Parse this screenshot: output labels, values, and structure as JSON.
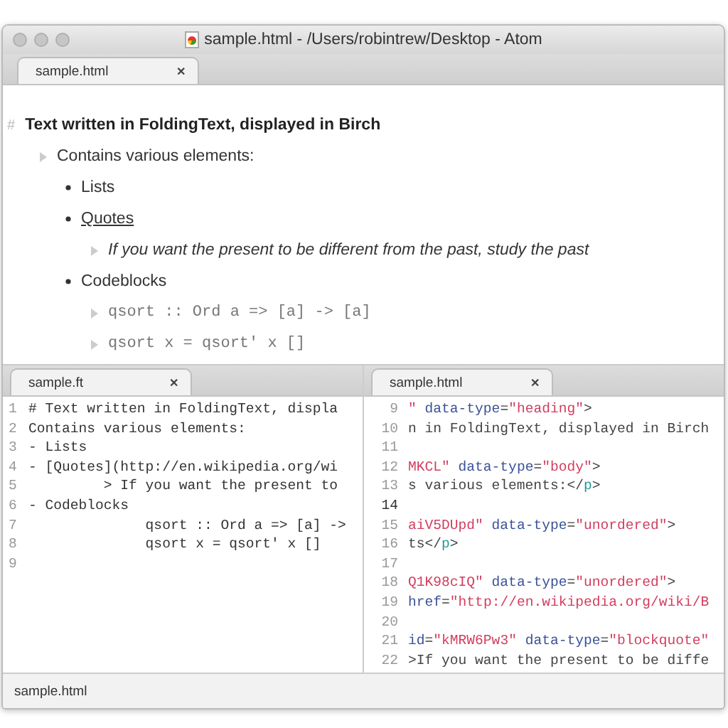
{
  "window": {
    "title": "sample.html - /Users/robintrew/Desktop - Atom"
  },
  "top_tabs": [
    {
      "label": "sample.html",
      "close": "✕",
      "selected": true
    }
  ],
  "preview": [
    {
      "kind": "heading",
      "marker": "#",
      "text": "Text written in FoldingText, displayed in Birch",
      "children": [
        {
          "kind": "item",
          "text": "Contains various elements:",
          "children": [
            {
              "kind": "bullet",
              "text": "Lists"
            },
            {
              "kind": "link",
              "text": "Quotes",
              "children": [
                {
                  "kind": "quote",
                  "text": "If you want the present to be different from the past, study the past"
                }
              ]
            },
            {
              "kind": "bullet",
              "text": "Codeblocks",
              "children": [
                {
                  "kind": "code",
                  "text": "qsort :: Ord a => [a] -> [a]"
                },
                {
                  "kind": "code",
                  "text": "qsort x = qsort' x []"
                }
              ]
            }
          ]
        }
      ]
    }
  ],
  "left_pane": {
    "tab": {
      "label": "sample.ft",
      "close": "✕",
      "selected": true
    },
    "lines": [
      {
        "number": "1",
        "text": "# Text written in FoldingText, displa"
      },
      {
        "number": "2",
        "text": "Contains various elements:"
      },
      {
        "number": "3",
        "text": "- Lists"
      },
      {
        "number": "4",
        "text": "- [Quotes](http://en.wikipedia.org/wi"
      },
      {
        "number": "5",
        "text": "         > If you want the present to"
      },
      {
        "number": "6",
        "text": "- Codeblocks"
      },
      {
        "number": "7",
        "text": "              qsort :: Ord a => [a] ->"
      },
      {
        "number": "8",
        "text": "              qsort x = qsort' x []"
      },
      {
        "number": "9"
      }
    ]
  },
  "right_pane": {
    "tab": {
      "label": "sample.html",
      "close": "✕",
      "selected": true
    },
    "lines": [
      {
        "number": "9",
        "current": false,
        "tokens": [
          {
            "kind": "str",
            "text": "\""
          },
          {
            "kind": "attr",
            "text": " data-type"
          },
          {
            "kind": "plain",
            "text": "="
          },
          {
            "kind": "str",
            "text": "\"heading\""
          },
          {
            "kind": "plain",
            "text": ">"
          }
        ]
      },
      {
        "number": "10",
        "current": false,
        "tokens": [
          {
            "kind": "plain",
            "text": "n in FoldingText, displayed in Birch"
          }
        ]
      },
      {
        "number": "11",
        "current": false
      },
      {
        "number": "12",
        "current": false,
        "tokens": [
          {
            "kind": "str",
            "text": "MKCL\""
          },
          {
            "kind": "attr",
            "text": " data-type"
          },
          {
            "kind": "plain",
            "text": "="
          },
          {
            "kind": "str",
            "text": "\"body\""
          },
          {
            "kind": "plain",
            "text": ">"
          }
        ]
      },
      {
        "number": "13",
        "current": false,
        "tokens": [
          {
            "kind": "plain",
            "text": "s various elements:</"
          },
          {
            "kind": "tag",
            "text": "p"
          },
          {
            "kind": "plain",
            "text": ">"
          }
        ]
      },
      {
        "number": "14",
        "current": true
      },
      {
        "number": "15",
        "current": false,
        "tokens": [
          {
            "kind": "str",
            "text": "aiV5DUpd\""
          },
          {
            "kind": "attr",
            "text": " data-type"
          },
          {
            "kind": "plain",
            "text": "="
          },
          {
            "kind": "str",
            "text": "\"unordered\""
          },
          {
            "kind": "plain",
            "text": ">"
          }
        ]
      },
      {
        "number": "16",
        "current": false,
        "tokens": [
          {
            "kind": "plain",
            "text": "ts</"
          },
          {
            "kind": "tag",
            "text": "p"
          },
          {
            "kind": "plain",
            "text": ">"
          }
        ]
      },
      {
        "number": "17",
        "current": false
      },
      {
        "number": "18",
        "current": false,
        "tokens": [
          {
            "kind": "str",
            "text": "Q1K98cIQ\""
          },
          {
            "kind": "attr",
            "text": " data-type"
          },
          {
            "kind": "plain",
            "text": "="
          },
          {
            "kind": "str",
            "text": "\"unordered\""
          },
          {
            "kind": "plain",
            "text": ">"
          }
        ]
      },
      {
        "number": "19",
        "current": false,
        "tokens": [
          {
            "kind": "attr",
            "text": "href"
          },
          {
            "kind": "plain",
            "text": "="
          },
          {
            "kind": "str",
            "text": "\"http://en.wikipedia.org/wiki/B"
          }
        ]
      },
      {
        "number": "20",
        "current": false
      },
      {
        "number": "21",
        "current": false,
        "tokens": [
          {
            "kind": "attr",
            "text": "id"
          },
          {
            "kind": "plain",
            "text": "="
          },
          {
            "kind": "str",
            "text": "\"kMRW6Pw3\""
          },
          {
            "kind": "attr",
            "text": " data-type"
          },
          {
            "kind": "plain",
            "text": "="
          },
          {
            "kind": "str",
            "text": "\"blockquote\""
          }
        ]
      },
      {
        "number": "22",
        "current": false,
        "tokens": [
          {
            "kind": "plain",
            "text": ">If you want the present to be diffe"
          }
        ]
      }
    ]
  },
  "status_bar": {
    "file": "sample.html"
  }
}
